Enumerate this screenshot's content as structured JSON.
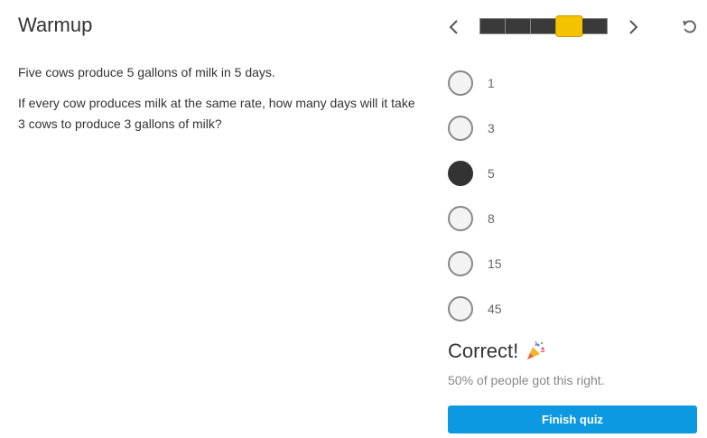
{
  "title": "Warmup",
  "question": {
    "line1": "Five cows produce 5 gallons of milk in 5 days.",
    "line2": "If every cow produces milk at the same rate, how many days will it take 3 cows to produce 3 gallons of milk?"
  },
  "progress": {
    "segments": 5,
    "current_index": 3
  },
  "options": [
    {
      "label": "1",
      "selected": false
    },
    {
      "label": "3",
      "selected": false
    },
    {
      "label": "5",
      "selected": true
    },
    {
      "label": "8",
      "selected": false
    },
    {
      "label": "15",
      "selected": false
    },
    {
      "label": "45",
      "selected": false
    }
  ],
  "result": {
    "text": "Correct!",
    "icon": "party-popper-icon",
    "stat": "50% of people got this right."
  },
  "finish_label": "Finish quiz",
  "colors": {
    "accent": "#0d99e2",
    "progress_knob": "#f5c200",
    "selected": "#333333"
  }
}
